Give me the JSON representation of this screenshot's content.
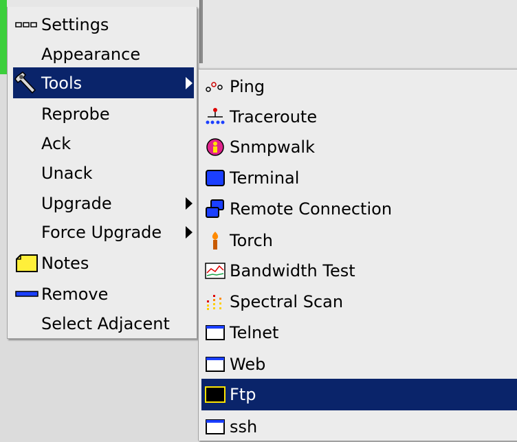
{
  "main_menu": {
    "items": [
      {
        "label": "Settings",
        "icon": "settings-dots-icon"
      },
      {
        "label": "Appearance",
        "icon": ""
      },
      {
        "label": "Tools",
        "icon": "wrench-icon",
        "submenu": true,
        "selected": true
      },
      {
        "label": "Reprobe",
        "icon": ""
      },
      {
        "label": "Ack",
        "icon": ""
      },
      {
        "label": "Unack",
        "icon": ""
      },
      {
        "label": "Upgrade",
        "icon": "",
        "submenu": true
      },
      {
        "label": "Force Upgrade",
        "icon": "",
        "submenu": true
      },
      {
        "label": "Notes",
        "icon": "note-icon"
      },
      {
        "label": "Remove",
        "icon": "minus-icon"
      },
      {
        "label": "Select Adjacent",
        "icon": ""
      }
    ]
  },
  "tools_submenu": {
    "items": [
      {
        "label": "Ping",
        "icon": "ping-icon"
      },
      {
        "label": "Traceroute",
        "icon": "traceroute-icon"
      },
      {
        "label": "Snmpwalk",
        "icon": "snmpwalk-icon"
      },
      {
        "label": "Terminal",
        "icon": "terminal-icon"
      },
      {
        "label": "Remote Connection",
        "icon": "remote-connection-icon"
      },
      {
        "label": "Torch",
        "icon": "torch-icon"
      },
      {
        "label": "Bandwidth Test",
        "icon": "bandwidth-icon"
      },
      {
        "label": "Spectral Scan",
        "icon": "spectral-scan-icon"
      },
      {
        "label": "Telnet",
        "icon": "window-icon"
      },
      {
        "label": "Web",
        "icon": "window-icon"
      },
      {
        "label": "Ftp",
        "icon": "ftp-icon",
        "selected": true
      },
      {
        "label": "ssh",
        "icon": "window-icon"
      }
    ]
  },
  "colors": {
    "selection": "#0a246a",
    "menu_bg": "#ececec"
  }
}
